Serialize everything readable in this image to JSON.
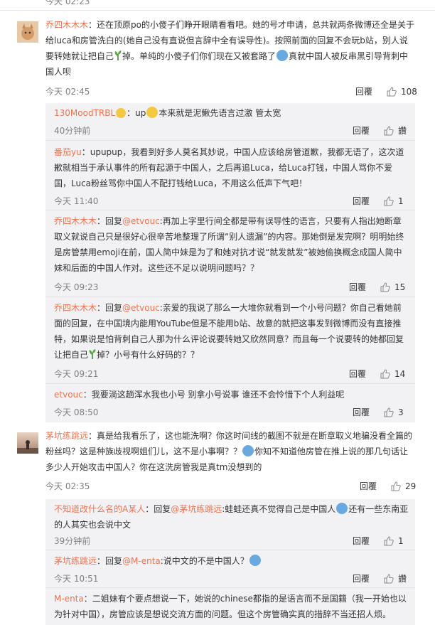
{
  "top_fragment": "今天 02:23",
  "labels": {
    "reply": "回覆",
    "like": "讚"
  },
  "comments": [
    {
      "user": "乔四木木木",
      "text_a": "：还在顶原po的小傻子们睁开眼睛看看吧。她的号才申请，总共就两条微博还全是关于给luca和房管洗白的(她自己没有直说但言辞中全有误导性)。按照前面的回复不会玩b站，别人说要转她就让把自己",
      "text_b": "掉。单纯的小傻子们你们现在又被套路了",
      "text_c": "真就中国人被反串黑引导背刺中国人呗",
      "time": "今天 02:45",
      "likes": "108"
    },
    {
      "user": "茅坑练跳远",
      "text_a": "：真是给我看乐了，这也能洗啊？你这时间线的截图不就是在断章取义地骗没看全篇的粉丝吗？这是种族歧视啊姐们儿，这不是小事啊？？",
      "text_b": "你知不知道他房管在推上说的那几句话让多少人开始攻击中国人？你在这洗房管我是真tm没想到的",
      "time": "今天 02:35",
      "likes": "29"
    }
  ],
  "replies": [
    {
      "user": "130MoodTRBL",
      "text_a": "：up",
      "text_b": "本来就是泥鳅先语言过激 管太宽",
      "time": "40分钟前",
      "likes": "讚"
    },
    {
      "user": "番茄yu",
      "text": "：upupup，我看到好多人莫名其妙说，中国人应该给房管道歉，我都无语了，这次道歉就相当于承认事件的所有起源于中国人，之后再追Luca，给Luca打钱，中国人骂你不爱国，Luca粉丝骂你中国人不配打钱给Luca，不用这么低声下气吧！",
      "time": "今天 11:40",
      "likes": "1"
    },
    {
      "user": "乔四木木木",
      "prefix": "：回复",
      "mention": "@etvouc",
      "text": ":再加上字里行间全都是带有误导性的语言，只要有人指出她断章取义就说自己只是很好心很辛苦地整理了所谓“别人遗漏”的内容。那她倒是发完啊？明明始终是房管禁用emoji在前，国人简中妹是为了和她对抗才说“就发就发”被她偷换概念成国人简中妹和后面的中国人作对。这些还不足以说明问题吗？？",
      "time": "今天 09:23",
      "likes": "15"
    },
    {
      "user": "乔四木木木",
      "prefix": "：回复",
      "mention": "@etvouc",
      "text_a": ":亲爱的我说了那么一大堆你就看到一个小号问题？你自己看她前面的回复，在中国境内能用YouTube但是不能用b站、故意的就把这事发到微博而没有直接推特，如果说是怕背刺自己人那为什么评论说要转她又欣然同意？而且每一个说要转的她都回复让把自己",
      "text_b": "掉？小号有什么好码的？？",
      "time": "今天 09:21",
      "likes": "14"
    },
    {
      "user": "etvouc",
      "text": "：我要淌这趟浑水我也小号 别拿小号说事 谁还不会怜惜下个人利益呢",
      "time": "今天 08:50",
      "likes": "3"
    },
    {
      "user": "不知道改什么名的A某人",
      "prefix": "：回复",
      "mention": "@茅坑练跳远",
      "text_a": ":蛙蛙还真不觉得自己是中国人",
      "text_b": "还有一些东南亚的人其实也会说中文",
      "time": "39分钟前",
      "likes": "1"
    },
    {
      "user": "茅坑练跳远",
      "prefix": "：回复",
      "mention": "@M-enta",
      "text": ":说中文的不是中国人？",
      "time": "今天 10:51",
      "likes": "讚"
    },
    {
      "user": "M-enta",
      "text": "：二姐妹有个要点想说一下，她说的chinese都指的是语言而不是国籍（我一开始也以为针对中国），房管应该是想说交流方面的问题。但这个房管确实真的措辞不当还招人烦。"
    }
  ],
  "icons": {
    "like": "thumbs-up-icon",
    "plant": "plant-emoji-icon",
    "crying": "crying-face-emoji-icon",
    "shark": "shark-emoji-icon",
    "face": "face-emoji-icon"
  },
  "colors": {
    "username": "#eb7350",
    "meta": "#808080",
    "reply_bg": "#f2f2f5"
  }
}
